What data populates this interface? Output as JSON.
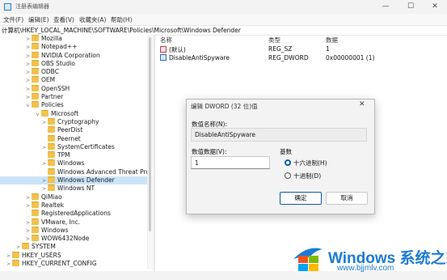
{
  "window": {
    "title": "注册表编辑器",
    "minimize": "—",
    "maximize": "☐",
    "close": "✕"
  },
  "menu": [
    "文件(F)",
    "编辑(E)",
    "查看(V)",
    "收藏夹(A)",
    "帮助(H)"
  ],
  "address": "计算机\\HKEY_LOCAL_MACHINE\\SOFTWARE\\Policies\\Microsoft\\Windows Defender",
  "tree": [
    {
      "label": "Mozilla",
      "depth": 0,
      "expand": ">"
    },
    {
      "label": "Notepad++",
      "depth": 0,
      "expand": ">"
    },
    {
      "label": "NVIDIA Corporation",
      "depth": 0,
      "expand": ">"
    },
    {
      "label": "OBS Studio",
      "depth": 0,
      "expand": ">"
    },
    {
      "label": "ODBC",
      "depth": 0,
      "expand": ">"
    },
    {
      "label": "OEM",
      "depth": 0,
      "expand": ">"
    },
    {
      "label": "OpenSSH",
      "depth": 0,
      "expand": ">"
    },
    {
      "label": "Partner",
      "depth": 0,
      "expand": ">"
    },
    {
      "label": "Policies",
      "depth": 0,
      "expand": "v"
    },
    {
      "label": "Microsoft",
      "depth": 1,
      "expand": "v"
    },
    {
      "label": "Cryptography",
      "depth": 2,
      "expand": ">"
    },
    {
      "label": "PeerDist",
      "depth": 2,
      "expand": ""
    },
    {
      "label": "Peernet",
      "depth": 2,
      "expand": ""
    },
    {
      "label": "SystemCertificates",
      "depth": 2,
      "expand": ">"
    },
    {
      "label": "TPM",
      "depth": 2,
      "expand": ""
    },
    {
      "label": "Windows",
      "depth": 2,
      "expand": ">"
    },
    {
      "label": "Windows Advanced Threat Prote",
      "depth": 2,
      "expand": ""
    },
    {
      "label": "Windows Defender",
      "depth": 2,
      "expand": ">",
      "selected": true
    },
    {
      "label": "Windows NT",
      "depth": 2,
      "expand": ">"
    },
    {
      "label": "QiMiao",
      "depth": 0,
      "expand": ">"
    },
    {
      "label": "Realtek",
      "depth": 0,
      "expand": ">"
    },
    {
      "label": "RegisteredApplications",
      "depth": 0,
      "expand": ""
    },
    {
      "label": "VMware, Inc.",
      "depth": 0,
      "expand": ">"
    },
    {
      "label": "Windows",
      "depth": 0,
      "expand": ">"
    },
    {
      "label": "WOW6432Node",
      "depth": 0,
      "expand": ">"
    },
    {
      "label": "SYSTEM",
      "depth": -1,
      "expand": ">"
    },
    {
      "label": "HKEY_USERS",
      "depth": -2,
      "expand": ">"
    },
    {
      "label": "HKEY_CURRENT_CONFIG",
      "depth": -2,
      "expand": ">"
    }
  ],
  "list": {
    "headers": {
      "name": "名称",
      "type": "类型",
      "data": "数据"
    },
    "rows": [
      {
        "name": "(默认)",
        "type": "REG_SZ",
        "data": "1",
        "icon": "ab-string-icon"
      },
      {
        "name": "DisableAntiSpyware",
        "type": "REG_DWORD",
        "data": "0x00000001 (1)",
        "icon": "binary-value-icon"
      }
    ]
  },
  "dialog": {
    "title": "编辑 DWORD (32 位)值",
    "close": "✕",
    "name_label": "数值名称(N):",
    "name_value": "DisableAntiSpyware",
    "data_label": "数值数据(V):",
    "data_value": "1",
    "base_label": "基数",
    "hex_label": "十六进制(H)",
    "dec_label": "十进制(D)",
    "ok": "确定",
    "cancel": "取消"
  },
  "watermark": {
    "brand": "Windows",
    "site_cn": "系统之家",
    "url": "www.bjjmlv.com"
  }
}
